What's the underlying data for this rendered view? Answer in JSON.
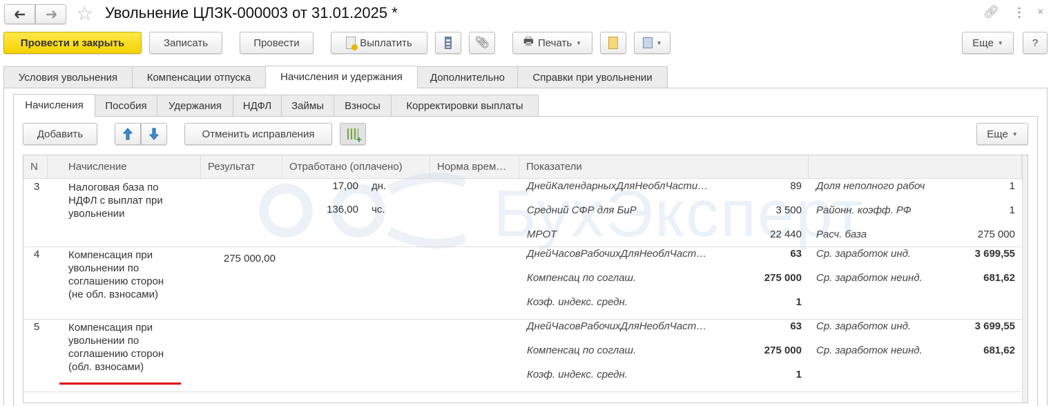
{
  "window": {
    "title": "Увольнение ЦЛЗК-000003 от 31.01.2025 *"
  },
  "toolbar": {
    "post_close": "Провести и закрыть",
    "save": "Записать",
    "post": "Провести",
    "pay": "Выплатить",
    "print": "Печать",
    "more": "Еще",
    "help": "?"
  },
  "tabs": [
    "Условия увольнения",
    "Компенсации отпуска",
    "Начисления и удержания",
    "Дополнительно",
    "Справки при увольнении"
  ],
  "subtabs": [
    "Начисления",
    "Пособия",
    "Удержания",
    "НДФЛ",
    "Займы",
    "Взносы",
    "Корректировки выплаты"
  ],
  "table_toolbar": {
    "add": "Добавить",
    "cancel_fixes": "Отменить исправления",
    "more": "Еще"
  },
  "table": {
    "columns": [
      "N",
      "Начисление",
      "Результат",
      "Отработано (оплачено)",
      "Норма врем…",
      "Показатели",
      ""
    ],
    "rows": [
      {
        "n": "3",
        "name": "Налоговая база по\nНДФЛ с выплат при\nувольнении",
        "result": "",
        "worked": [
          {
            "value": "17,00",
            "unit": "дн."
          },
          {
            "value": "136,00",
            "unit": "чс."
          }
        ],
        "indicators": [
          {
            "label": "ДнейКалендарныхДляНеоблЧасти…",
            "value": "89",
            "label2": "Доля неполного рабоч",
            "value2": "1",
            "bold": false
          },
          {
            "label": "Средний СФР для БиР",
            "value": "3 500",
            "label2": "Районн. коэфф. РФ",
            "value2": "1",
            "bold": false
          },
          {
            "label": "МРОТ",
            "value": "22 440",
            "label2": "Расч. база",
            "value2": "275 000",
            "bold": false
          }
        ]
      },
      {
        "n": "4",
        "name": "Компенсация при\nувольнении по\nсоглашению сторон\n(не обл. взносами)",
        "result": "275 000,00",
        "worked": [],
        "indicators": [
          {
            "label": "ДнейЧасовРабочихДляНеоблЧаст…",
            "value": "63",
            "label2": "Ср. заработок инд.",
            "value2": "3 699,55",
            "bold": true
          },
          {
            "label": "Компенсац по соглаш.",
            "value": "275 000",
            "label2": "Ср. заработок неинд.",
            "value2": "681,62",
            "bold": true
          },
          {
            "label": "Коэф. индекс. средн.",
            "value": "1",
            "label2": "",
            "value2": "",
            "bold": true
          }
        ]
      },
      {
        "n": "5",
        "name": "Компенсация при\nувольнении по\nсоглашению сторон\n(обл. взносами)",
        "result": "",
        "worked": [],
        "indicators": [
          {
            "label": "ДнейЧасовРабочихДляНеоблЧаст…",
            "value": "63",
            "label2": "Ср. заработок инд.",
            "value2": "3 699,55",
            "bold": true
          },
          {
            "label": "Компенсац по соглаш.",
            "value": "275 000",
            "label2": "Ср. заработок неинд.",
            "value2": "681,62",
            "bold": true
          },
          {
            "label": "Коэф. индекс. средн.",
            "value": "1",
            "label2": "",
            "value2": "",
            "bold": true
          }
        ]
      }
    ]
  },
  "watermark": "БухЭксперт",
  "colors": {
    "primary": "#f5d300",
    "highlight_underline": "#e00000",
    "arrow": "#3a8fd8"
  }
}
